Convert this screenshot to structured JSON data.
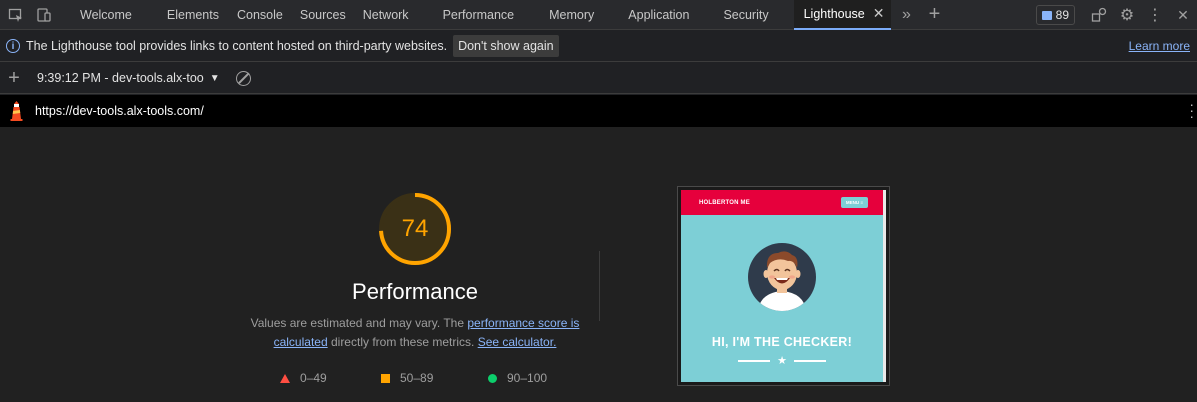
{
  "tabs": [
    {
      "label": "Welcome"
    },
    {
      "label": "Elements"
    },
    {
      "label": "Console"
    },
    {
      "label": "Sources"
    },
    {
      "label": "Network"
    },
    {
      "label": "Performance"
    },
    {
      "label": "Memory"
    },
    {
      "label": "Application"
    },
    {
      "label": "Security"
    },
    {
      "label": "Lighthouse"
    }
  ],
  "issues_count": "89",
  "infobar": {
    "message": "The Lighthouse tool provides links to content hosted on third-party websites.",
    "dismiss_label": "Don't show again",
    "learn_more": "Learn more"
  },
  "report": {
    "selected": "9:39:12 PM - dev-tools.alx-too",
    "url": "https://dev-tools.alx-tools.com/"
  },
  "score": {
    "value": 74,
    "color": "#ffa400",
    "title": "Performance",
    "desc_1": "Values are estimated and may vary. The ",
    "link_1": "performance score is calculated",
    "desc_2": " directly from these metrics. ",
    "link_2": "See calculator."
  },
  "legend": [
    {
      "range": "0–49",
      "color": "#ff4e42",
      "shape": "triangle"
    },
    {
      "range": "50–89",
      "color": "#ffa400",
      "shape": "square"
    },
    {
      "range": "90–100",
      "color": "#0cce6b",
      "shape": "circle"
    }
  ],
  "screenshot": {
    "brand": "HOLBERTON ME",
    "menu": "MENU ≡",
    "heading": "HI, I'M THE CHECKER!",
    "star": "★"
  }
}
